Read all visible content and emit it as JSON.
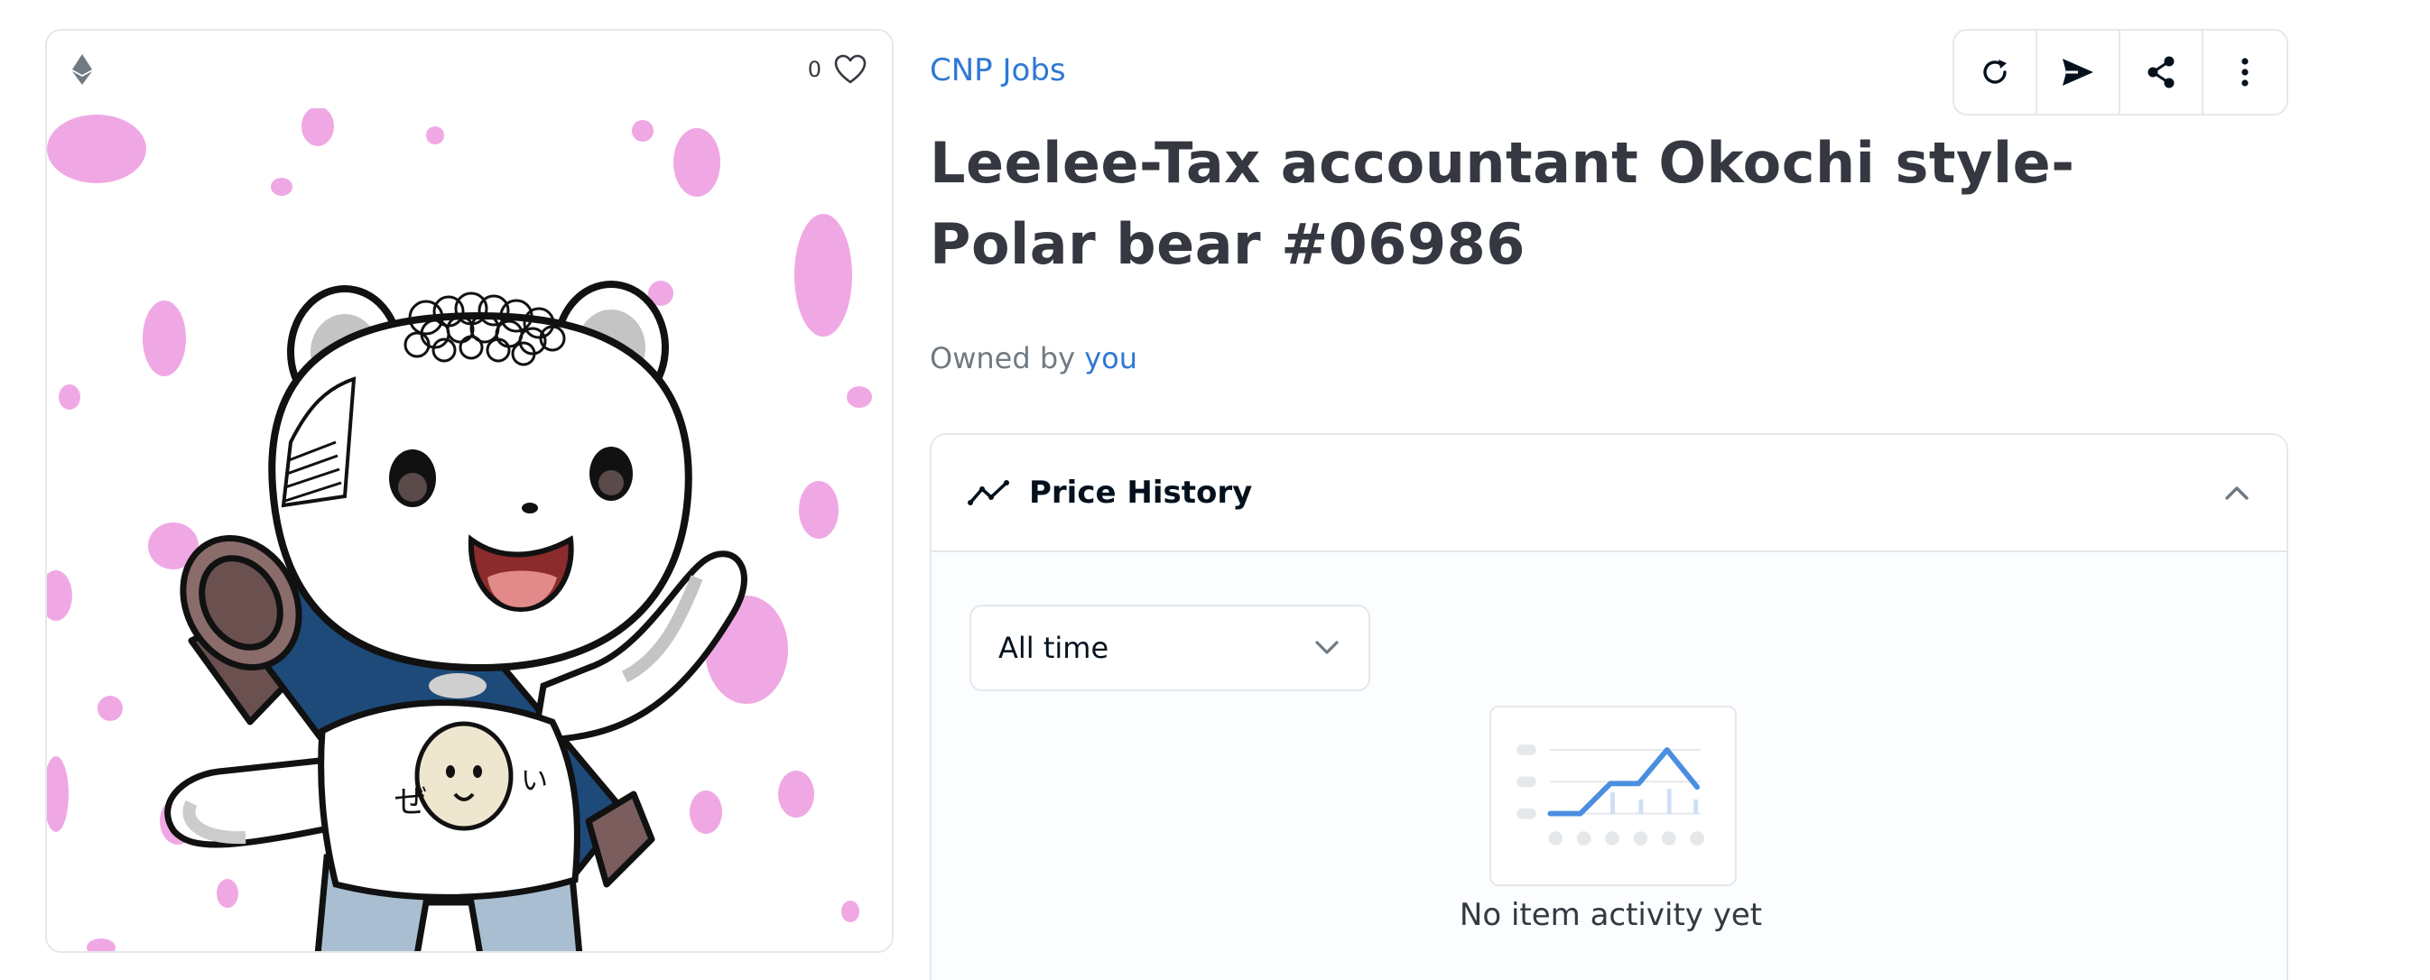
{
  "media": {
    "chain_icon": "ethereum-icon",
    "favorite_count": "0",
    "favorite_icon": "heart-outline-icon"
  },
  "collection": {
    "name": "CNP Jobs"
  },
  "actions": [
    {
      "icon": "refresh-icon"
    },
    {
      "icon": "transfer-icon"
    },
    {
      "icon": "share-icon"
    },
    {
      "icon": "more-vertical-icon"
    }
  ],
  "item": {
    "title": "Leelee-Tax accountant Okochi style-Polar bear #06986",
    "owned_prefix": "Owned by",
    "owner": "you"
  },
  "price_history": {
    "title": "Price History",
    "icon": "trending-line-icon",
    "collapse_icon": "chevron-up-icon",
    "time_filter": "All time",
    "empty_text": "No item activity yet"
  },
  "colors": {
    "link_blue": "#2f78d4",
    "text_dark": "#353840",
    "border": "#e5e8eb",
    "petal_pink": "#ec9ee0"
  }
}
